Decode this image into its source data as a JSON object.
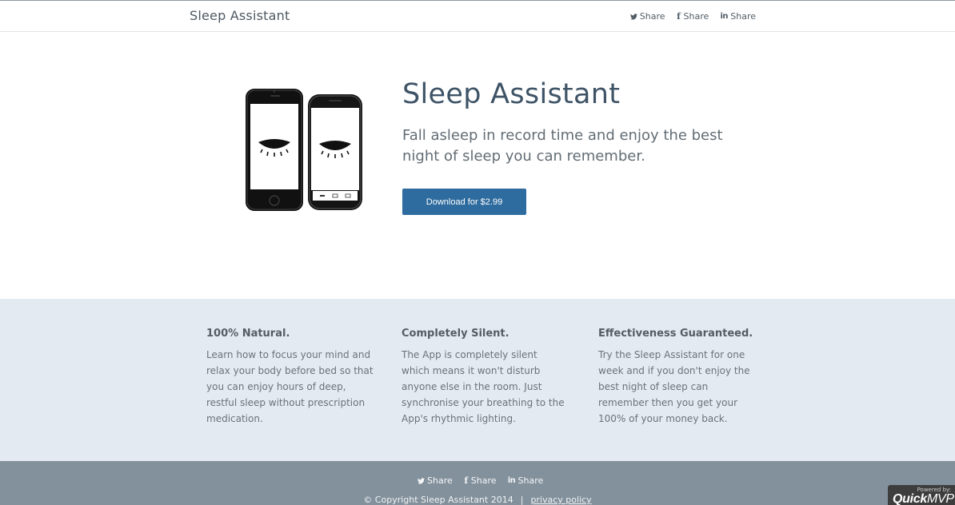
{
  "nav": {
    "brand": "Sleep Assistant",
    "share": [
      {
        "icon": "twitter-icon",
        "label": "Share"
      },
      {
        "icon": "facebook-icon",
        "label": "Share"
      },
      {
        "icon": "linkedin-icon",
        "label": "Share"
      }
    ]
  },
  "hero": {
    "title": "Sleep Assistant",
    "subtitle": "Fall asleep in record time and enjoy the best night of sleep you can remember.",
    "cta_label": "Download for $2.99"
  },
  "features": [
    {
      "title": "100% Natural.",
      "text": "Learn how to focus your mind and relax your body before bed so that you can enjoy hours of deep, restful sleep without prescription medication."
    },
    {
      "title": "Completely Silent.",
      "text": "The App is completely silent which means it won't disturb anyone else in the room. Just synchronise your breathing to the App's rhythmic lighting."
    },
    {
      "title": "Effectiveness Guaranteed.",
      "text": "Try the Sleep Assistant for one week and if you don't enjoy the best night of sleep can remember then you get your 100% of your money back."
    }
  ],
  "footer": {
    "share": [
      {
        "icon": "twitter-icon",
        "label": "Share"
      },
      {
        "icon": "facebook-icon",
        "label": "Share"
      },
      {
        "icon": "linkedin-icon",
        "label": "Share"
      }
    ],
    "copyright": "© Copyright Sleep Assistant 2014",
    "separator": "|",
    "privacy_label": "privacy policy"
  },
  "badge": {
    "small_text": "Powered by:",
    "logo_bold": "Quick",
    "logo_rest": "MVP"
  },
  "colors": {
    "accent": "#2e6b9e",
    "features_bg": "#e4eaf1",
    "footer_bg": "#83919c"
  }
}
